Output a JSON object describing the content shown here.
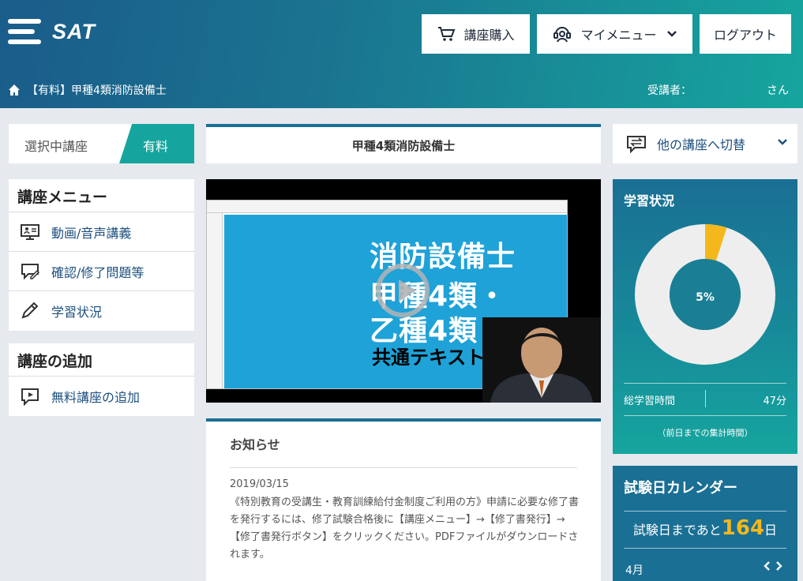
{
  "header": {
    "logo_text": "SAT",
    "buy_label": "講座購入",
    "mymenu_label": "マイメニュー",
    "logout_label": "ログアウト",
    "breadcrumb": "【有料】甲種4類消防設備士",
    "student_label": "受講者：",
    "student_suffix": "さん"
  },
  "left": {
    "selected_label": "選択中講座",
    "selected_badge": "有料",
    "course_menu": {
      "title": "講座メニュー",
      "items": [
        {
          "label": "動画/音声講義",
          "icon": "monitor-icon"
        },
        {
          "label": "確認/修了問題等",
          "icon": "chat-pencil-icon"
        },
        {
          "label": "学習状況",
          "icon": "pencil-icon"
        }
      ]
    },
    "add_menu": {
      "title": "講座の追加",
      "items": [
        {
          "label": "無料講座の追加",
          "icon": "play-chat-icon"
        }
      ]
    }
  },
  "center": {
    "course_title": "甲種4類消防設備士",
    "video": {
      "slide_line1": "消防設備士",
      "slide_line2": "甲種4類・",
      "slide_line3": "乙種4類",
      "slide_line4": "共通テキスト"
    },
    "notice": {
      "title": "お知らせ",
      "date": "2019/03/15",
      "body": "《特別教育の受講生・教育訓練給付金制度ご利用の方》申請に必要な修了書を発行するには、修了試験合格後に【講座メニュー】→【修了書発行】→【修了書発行ボタン】をクリックください。PDFファイルがダウンロードされます。"
    }
  },
  "right": {
    "switch_label": "他の講座へ切替",
    "status": {
      "title": "学習状況",
      "progress_percent": 5,
      "progress_label": "5%",
      "total_time_label": "総学習時間",
      "total_time_value": "47分",
      "note": "（前日までの集計時間）"
    },
    "calendar": {
      "title": "試験日カレンダー",
      "count_prefix": "試験日まであと",
      "count_value": "164",
      "count_suffix": "日",
      "month": "4月"
    }
  },
  "colors": {
    "accent_teal": "#16a59e",
    "accent_blue": "#1a6f94",
    "countdown_orange": "#f4b81c",
    "progress_gold": "#f4b81c"
  }
}
